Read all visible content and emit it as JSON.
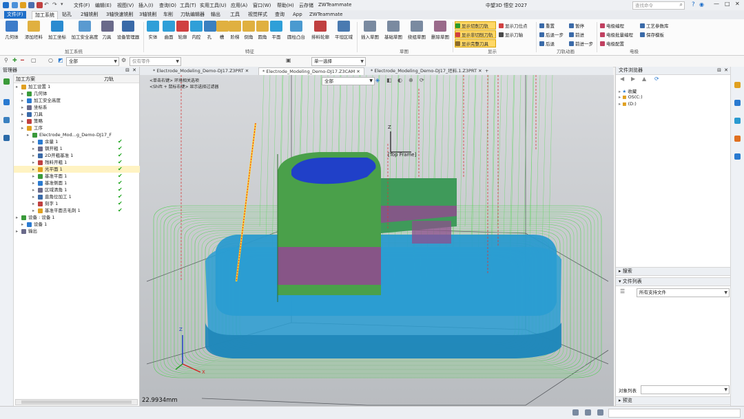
{
  "app": {
    "title": "中望3D 悟空 2027",
    "search_placeholder": "查找命令"
  },
  "menubar": [
    "文件(F)",
    "编辑(E)",
    "视图(V)",
    "插入(I)",
    "查询(O)",
    "工具(T)",
    "实用工具(U)",
    "应用(A)",
    "窗口(W)",
    "帮助(H)",
    "云存储",
    "ZWTeammate"
  ],
  "ribbon_tabs": [
    "文件(F)",
    "加工系统",
    "钻孔",
    "2轴铣削",
    "3轴快速铣削",
    "3轴铣削",
    "车削",
    "刀轨编辑器",
    "输出",
    "工具",
    "视觉样式",
    "查询",
    "App",
    "ZWTeammate"
  ],
  "ribbon": {
    "group1": {
      "label": "加工系统",
      "buttons": [
        "几何体",
        "添加坯料",
        "加工坐标",
        "加工安全高度",
        "刀具",
        "设备管理器"
      ]
    },
    "group2": {
      "label": "特征",
      "buttons": [
        "实体",
        "曲面",
        "轮廓",
        "内腔",
        "孔",
        "槽",
        "阶梯",
        "倒角",
        "圆角",
        "平面",
        "圆柱凸台",
        "排料轮廓",
        "平坦区域"
      ]
    },
    "group3": {
      "label": "草图",
      "buttons": [
        "插入草图",
        "基础草图",
        "绕组草图",
        "删除草图"
      ]
    },
    "group4": {
      "label": "显示",
      "buttons": [
        "显示切削刀轨",
        "显示非切削刀轨",
        "显示完整刀具",
        "显示刀位点",
        "显示刀轴"
      ]
    },
    "group5": {
      "label": "刀轨动画",
      "buttons": [
        "重置",
        "暂停",
        "后退一步",
        "前进",
        "后退",
        "前进一步"
      ]
    },
    "group6": {
      "label": "电极",
      "buttons": [
        "电极编程",
        "工艺参数库",
        "电极批量编程",
        "保存模板",
        "电极配置"
      ]
    }
  },
  "toolbar2": {
    "filter_value": "全部",
    "part_placeholder": "仅有零件",
    "select_mode": "单一选择"
  },
  "left_panel": {
    "title": "管理器",
    "col_plan": "加工方案",
    "col_toolpath": "刀轨",
    "tree": [
      {
        "label": "加工设置 1",
        "indent": 0,
        "check": false
      },
      {
        "label": "几何体",
        "indent": 1,
        "check": false
      },
      {
        "label": "加工安全高度",
        "indent": 1,
        "check": false
      },
      {
        "label": "坐标系",
        "indent": 1,
        "check": false
      },
      {
        "label": "刀具",
        "indent": 1,
        "check": false
      },
      {
        "label": "策略",
        "indent": 1,
        "check": false
      },
      {
        "label": "工序",
        "indent": 1,
        "check": false
      },
      {
        "label": "Electrode_Mod...g_Demo-DJ17_F",
        "indent": 2,
        "check": false
      },
      {
        "label": "余量 1",
        "indent": 3,
        "check": true
      },
      {
        "label": "钢开粗 1",
        "indent": 3,
        "check": true
      },
      {
        "label": "2D开粗基准 1",
        "indent": 3,
        "check": true
      },
      {
        "label": "残料开粗 1",
        "indent": 3,
        "check": true
      },
      {
        "label": "光平面 1",
        "indent": 3,
        "check": true,
        "selected": true
      },
      {
        "label": "基准平面 1",
        "indent": 3,
        "check": true
      },
      {
        "label": "基准侧面 1",
        "indent": 3,
        "check": true
      },
      {
        "label": "区域清角 1",
        "indent": 3,
        "check": true
      },
      {
        "label": "直角位加工 1",
        "indent": 3,
        "check": true
      },
      {
        "label": "刻字 1",
        "indent": 3,
        "check": true
      },
      {
        "label": "基准平面去毛刺 1",
        "indent": 3,
        "check": true
      },
      {
        "label": "设备 : 设备 1",
        "indent": 0,
        "check": false
      },
      {
        "label": "设备 1",
        "indent": 1,
        "check": false
      },
      {
        "label": "输出",
        "indent": 0,
        "check": false
      }
    ]
  },
  "doc_tabs": [
    "* Electrode_Modeling_Demo-DJ17.Z3PRT",
    "* Electrode_Modeling_Demo-DJ17.Z3CAM",
    "* Electrode_Modeling_Demo-DJ17_坯料.1.Z3PRT"
  ],
  "viewport": {
    "hint1": "<单击右键> 环境相关选项",
    "hint2": "<Shift + 鼠标右键> 显示选择过滤器",
    "filter_value": "全部",
    "frame_label": "[Top Frame]",
    "measure": "22.9934mm",
    "axis_z": "Z",
    "axis_x": "X"
  },
  "right_panel": {
    "title": "文件浏览器",
    "tree": [
      "收藏",
      "OS(C:)",
      "(D:)"
    ],
    "sec_search": "搜索",
    "sec_filelist": "文件列表",
    "file_filter": "所有支持文件",
    "obj_list_label": "对象列表",
    "sec_preview": "预览"
  },
  "colors": {
    "accent": "#1f6fc9",
    "toolpath_green": "#3ad13a",
    "part_teal": "#2a9fd0",
    "highlight": "#ffd866"
  }
}
